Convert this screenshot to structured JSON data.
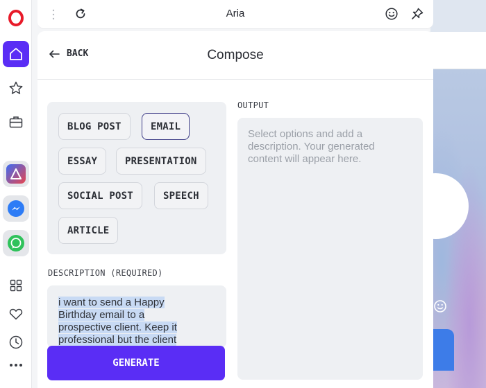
{
  "panel": {
    "title": "Aria"
  },
  "compose": {
    "back_label": "BACK",
    "title": "Compose",
    "content_types": [
      "BLOG POST",
      "EMAIL",
      "ESSAY",
      "PRESENTATION",
      "SOCIAL POST",
      "SPEECH",
      "ARTICLE"
    ],
    "selected_type": "EMAIL",
    "description_label": "DESCRIPTION (REQUIRED)",
    "description_value": "i want to send a Happy Birthday email to a prospective client. Keep it professional but the client",
    "output_label": "OUTPUT",
    "output_placeholder": "Select options and add a description. Your generated content will appear here.",
    "generate_label": "GENERATE"
  },
  "sidebar": {
    "icons": [
      "opera-logo-icon",
      "home-icon",
      "star-icon",
      "briefcase-icon",
      "aria-app-icon",
      "messenger-icon",
      "whatsapp-icon",
      "grid-icon",
      "heart-icon",
      "clock-icon",
      "more-icon"
    ]
  },
  "colors": {
    "accent": "#5a2df5",
    "selected_chip_border": "#3c3a86",
    "opera_red": "#e81b2a"
  }
}
